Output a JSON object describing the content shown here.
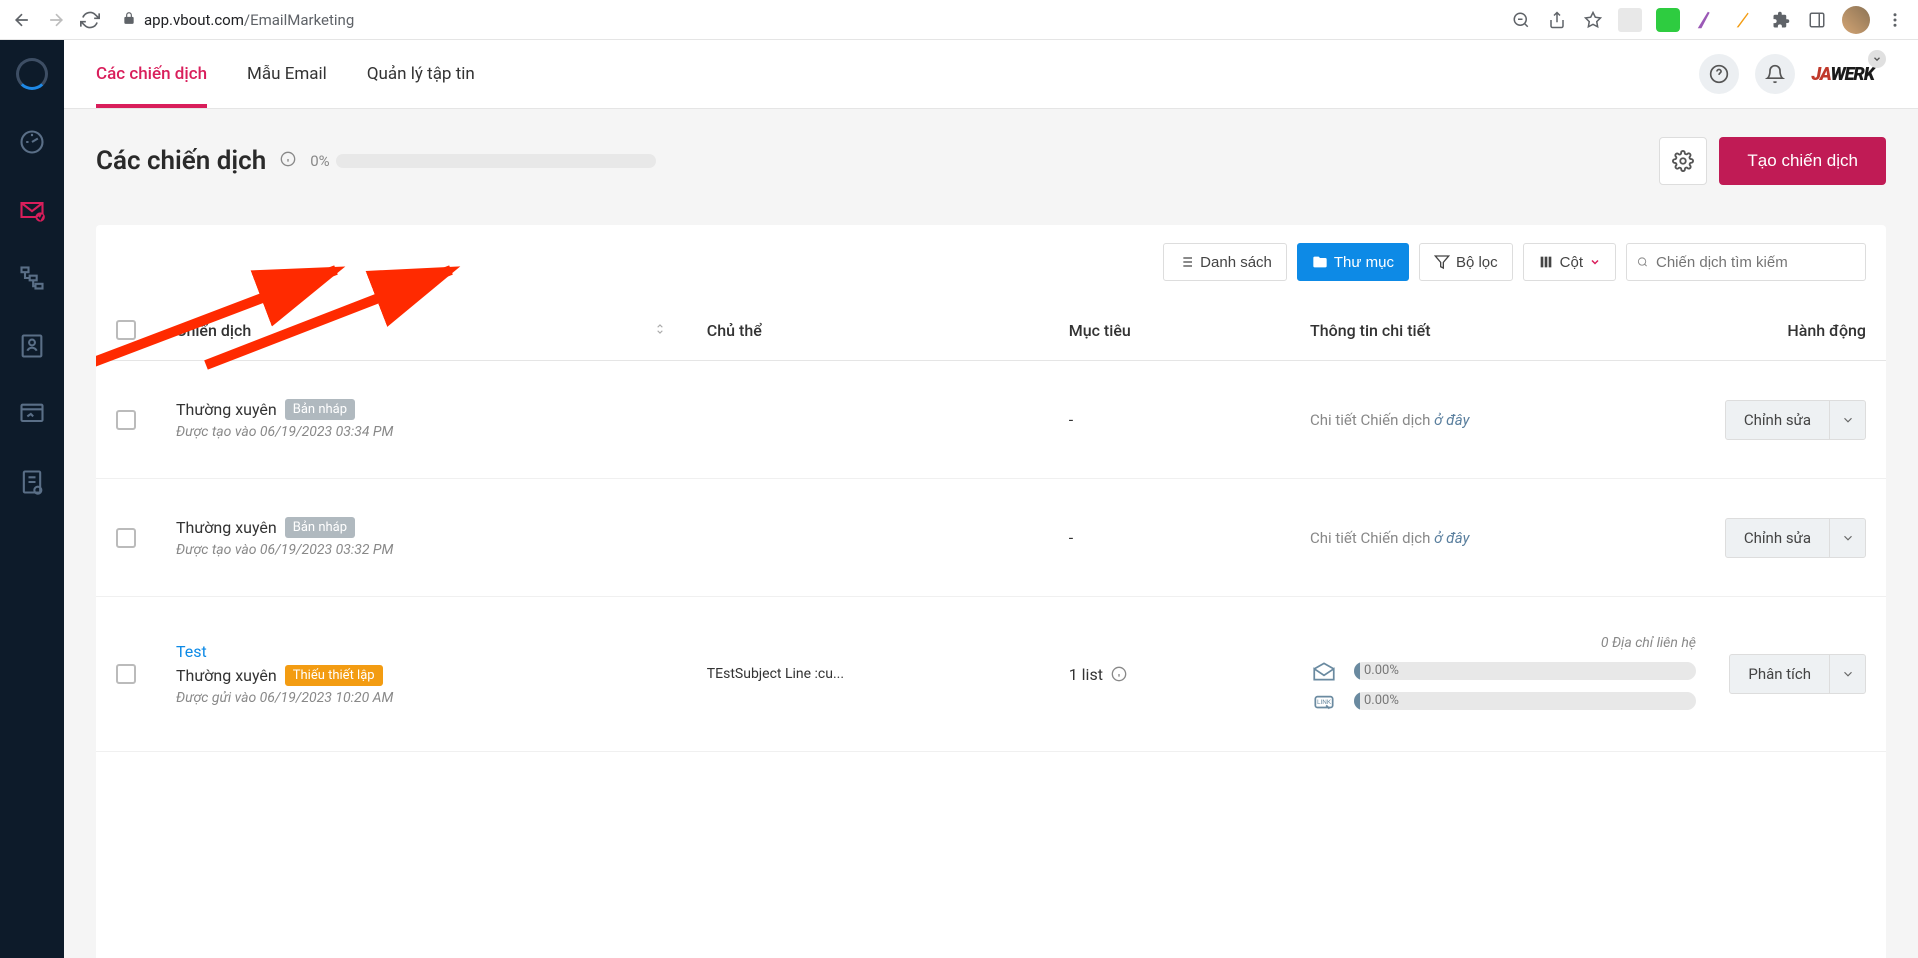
{
  "browser": {
    "url_host": "app.vbout.com",
    "url_path": "/EmailMarketing"
  },
  "tabs": {
    "campaigns": "Các chiến dịch",
    "templates": "Mẫu Email",
    "files": "Quản lý tập tin"
  },
  "page": {
    "title": "Các chiến dịch",
    "progress_pct": "0%"
  },
  "buttons": {
    "create": "Tạo chiến dịch",
    "list": "Danh sách",
    "folder": "Thư mục",
    "filter": "Bộ lọc",
    "columns": "Cột"
  },
  "search": {
    "placeholder": "Chiến dịch tìm kiếm"
  },
  "columns": {
    "campaign": "Chiến dịch",
    "subject": "Chủ thể",
    "target": "Mục tiêu",
    "details": "Thông tin chi tiết",
    "actions": "Hành động"
  },
  "badges": {
    "draft": "Bản nháp",
    "missing": "Thiếu thiết lập"
  },
  "actions": {
    "edit": "Chỉnh sửa",
    "analyze": "Phân tích"
  },
  "detail_link": {
    "prefix": "Chi tiết Chiến dịch ",
    "here": "ở đây"
  },
  "rows": [
    {
      "type": "Thường xuyên",
      "badge": "draft",
      "meta": "Được tạo vào 06/19/2023 03:34 PM",
      "subject": "",
      "target": "-",
      "detail_mode": "link",
      "action": "edit"
    },
    {
      "type": "Thường xuyên",
      "badge": "draft",
      "meta": "Được tạo vào 06/19/2023 03:32 PM",
      "subject": "",
      "target": "-",
      "detail_mode": "link",
      "action": "edit"
    },
    {
      "title": "Test",
      "type": "Thường xuyên",
      "badge": "missing",
      "meta": "Được gửi vào 06/19/2023 10:20 AM",
      "subject": "TEstSubject Line :cu...",
      "target": "1 list",
      "detail_mode": "stats",
      "stats_header": "0 Địa chỉ liên hệ",
      "stat1": "0.00%",
      "stat2": "0.00%",
      "action": "analyze"
    }
  ]
}
